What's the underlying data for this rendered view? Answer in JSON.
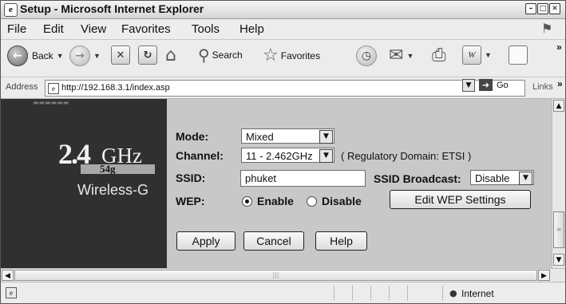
{
  "window": {
    "title": "Setup - Microsoft Internet Explorer"
  },
  "menu": {
    "items": [
      "File",
      "Edit",
      "View",
      "Favorites",
      "Tools",
      "Help"
    ]
  },
  "toolbar": {
    "back_label": "Back",
    "search_label": "Search",
    "favorites_label": "Favorites",
    "overflow": "»"
  },
  "address": {
    "label": "Address",
    "url": "http://192.168.3.1/index.asp",
    "go_label": "Go",
    "links_label": "Links"
  },
  "brand": {
    "number": "2.4",
    "unit": "GHz",
    "standard": "54g",
    "product": "Wireless-G"
  },
  "form": {
    "mode_label": "Mode:",
    "mode_value": "Mixed",
    "channel_label": "Channel:",
    "channel_value": "11 - 2.462GHz",
    "regulatory_note": "( Regulatory Domain: ETSI )",
    "ssid_label": "SSID:",
    "ssid_value": "phuket",
    "ssid_broadcast_label": "SSID Broadcast:",
    "ssid_broadcast_value": "Disable",
    "wep_label": "WEP:",
    "wep_enable": "Enable",
    "wep_disable": "Disable",
    "wep_selected": "Enable",
    "edit_wep_button": "Edit WEP Settings",
    "apply_button": "Apply",
    "cancel_button": "Cancel",
    "help_button": "Help"
  },
  "status": {
    "zone": "Internet"
  }
}
